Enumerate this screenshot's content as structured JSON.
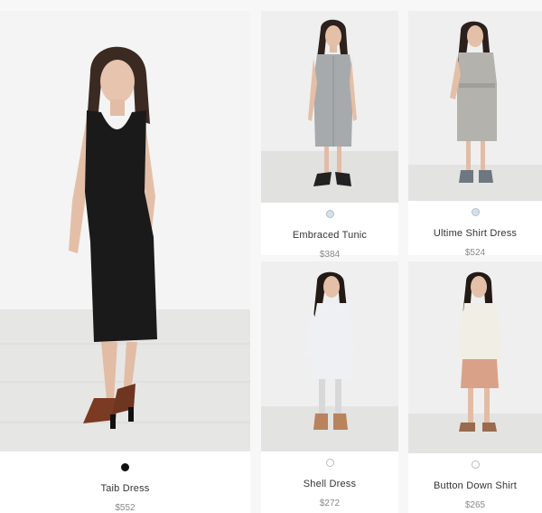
{
  "products": [
    {
      "name": "Taib Dress",
      "price": "$552",
      "swatch_color": "#111111",
      "garment_color": "#1a1a1a"
    },
    {
      "name": "Embraced Tunic",
      "price": "$384",
      "swatch_color": "#cfe2f3",
      "garment_color": "#a7aaad"
    },
    {
      "name": "Ultime Shirt Dress",
      "price": "$524",
      "swatch_color": "#cfe2f3",
      "garment_color": "#b3b2ac"
    },
    {
      "name": "Shell Dress",
      "price": "$272",
      "swatch_color": "#ffffff",
      "garment_color": "#eef0f3"
    },
    {
      "name": "Button Down Shirt",
      "price": "$265",
      "swatch_color": "#ffffff",
      "garment_color": "#f1eee6"
    }
  ]
}
